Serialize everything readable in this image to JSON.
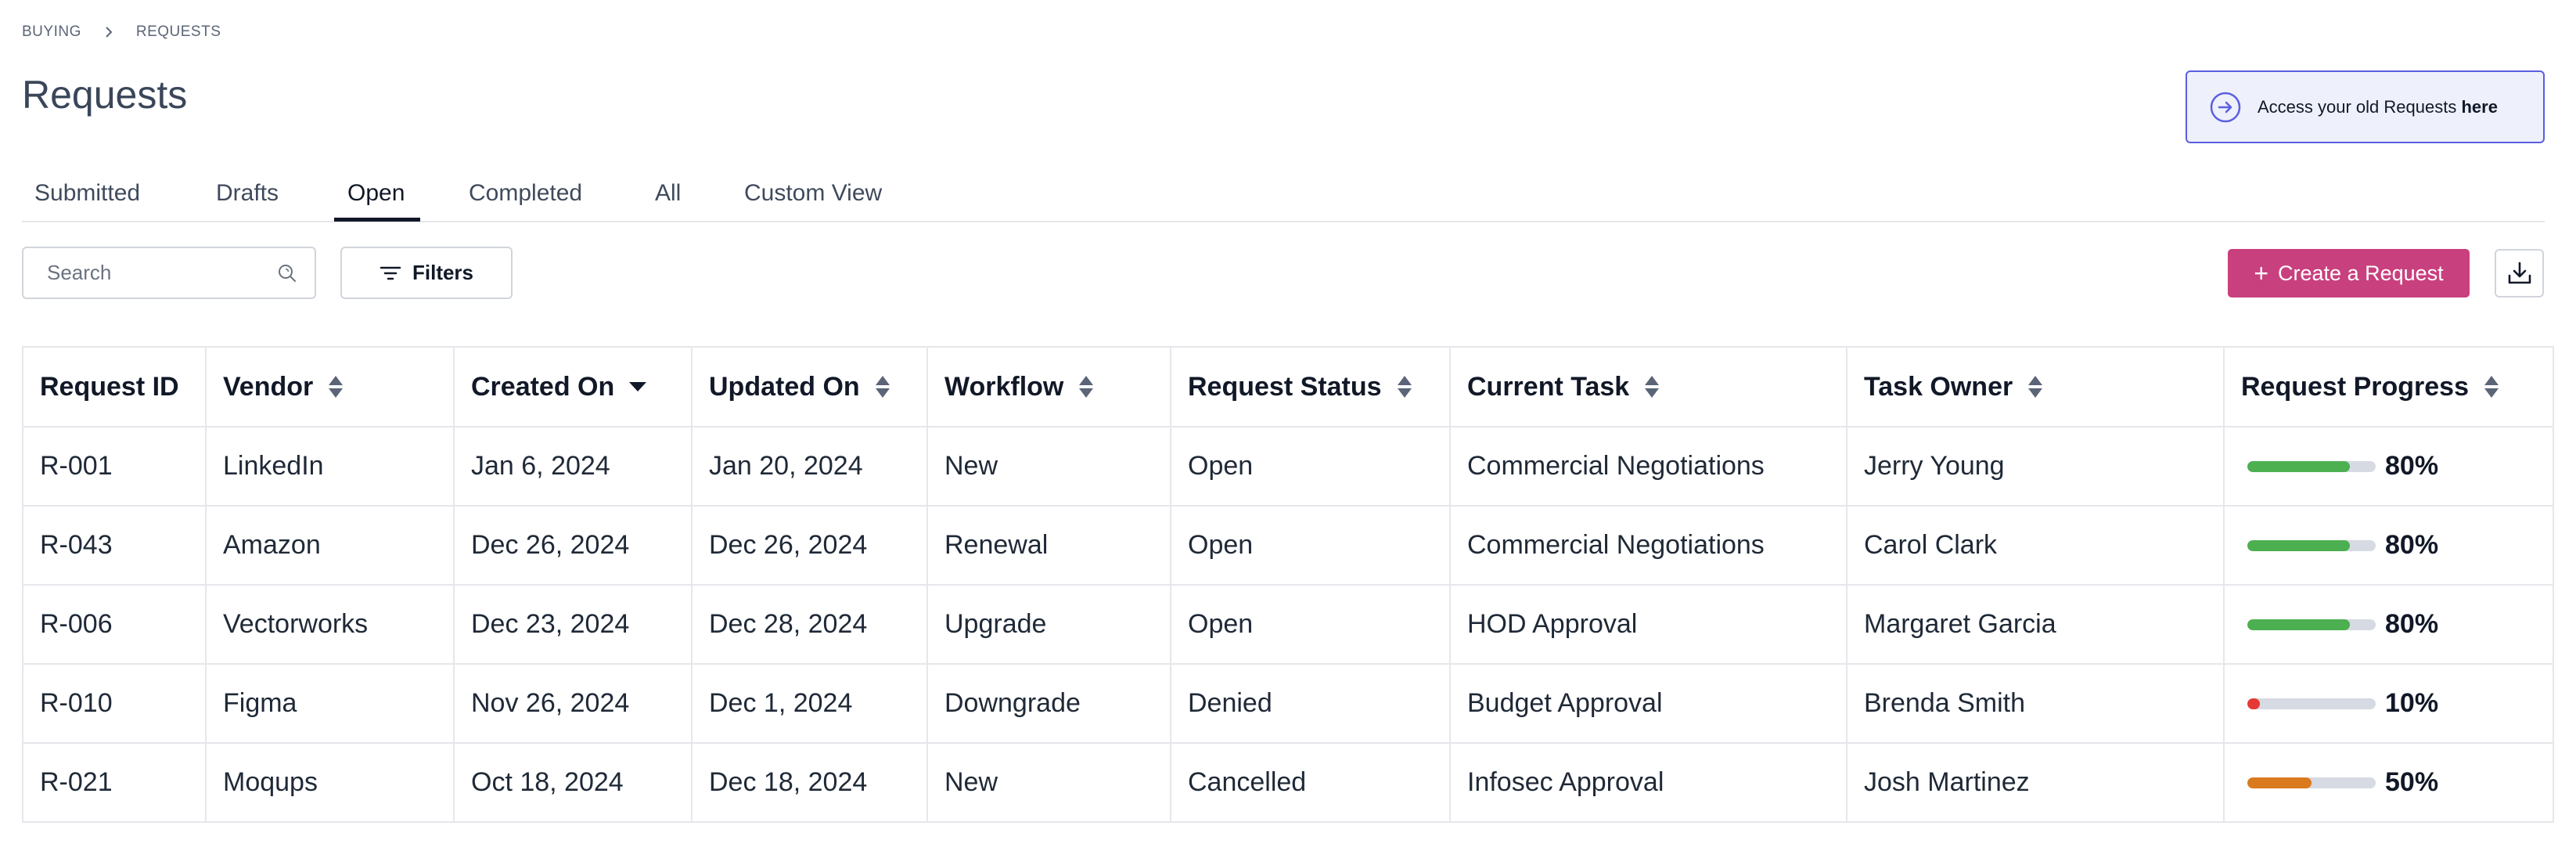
{
  "breadcrumb": {
    "items": [
      "BUYING",
      "REQUESTS"
    ]
  },
  "page": {
    "title": "Requests"
  },
  "old_requests": {
    "text": "Access your old Requests ",
    "link": "here"
  },
  "tabs": [
    {
      "label": "Submitted",
      "active": false
    },
    {
      "label": "Drafts",
      "active": false
    },
    {
      "label": "Open",
      "active": true
    },
    {
      "label": "Completed",
      "active": false
    },
    {
      "label": "All",
      "active": false
    },
    {
      "label": "Custom View",
      "active": false
    }
  ],
  "search": {
    "placeholder": "Search",
    "value": ""
  },
  "toolbar": {
    "filters_label": "Filters",
    "create_label": "Create a Request"
  },
  "colors": {
    "accent": "#c9407e",
    "green": "#4caf50",
    "red": "#e53935",
    "orange": "#d97a1e",
    "link_border": "#5a5fe0"
  },
  "table": {
    "columns": [
      {
        "label": "Request ID",
        "sort": "none"
      },
      {
        "label": "Vendor",
        "sort": "both"
      },
      {
        "label": "Created On",
        "sort": "desc"
      },
      {
        "label": "Updated On",
        "sort": "both"
      },
      {
        "label": "Workflow",
        "sort": "both"
      },
      {
        "label": "Request Status",
        "sort": "both"
      },
      {
        "label": "Current Task",
        "sort": "both"
      },
      {
        "label": "Task Owner",
        "sort": "both"
      },
      {
        "label": "Request Progress",
        "sort": "both"
      }
    ],
    "rows": [
      {
        "id": "R-001",
        "vendor": "LinkedIn",
        "created": "Jan 6, 2024",
        "updated": "Jan 20, 2024",
        "workflow": "New",
        "status": "Open",
        "task": "Commercial Negotiations",
        "owner": "Jerry Young",
        "progress": 80,
        "progress_label": "80%",
        "progress_color": "#4caf50"
      },
      {
        "id": "R-043",
        "vendor": "Amazon",
        "created": "Dec 26, 2024",
        "updated": "Dec 26, 2024",
        "workflow": "Renewal",
        "status": "Open",
        "task": "Commercial Negotiations",
        "owner": "Carol Clark",
        "progress": 80,
        "progress_label": "80%",
        "progress_color": "#4caf50"
      },
      {
        "id": "R-006",
        "vendor": "Vectorworks",
        "created": "Dec 23, 2024",
        "updated": "Dec 28, 2024",
        "workflow": "Upgrade",
        "status": "Open",
        "task": "HOD Approval",
        "owner": "Margaret Garcia",
        "progress": 80,
        "progress_label": "80%",
        "progress_color": "#4caf50"
      },
      {
        "id": "R-010",
        "vendor": "Figma",
        "created": "Nov 26, 2024",
        "updated": "Dec 1, 2024",
        "workflow": "Downgrade",
        "status": "Denied",
        "task": "Budget Approval",
        "owner": "Brenda Smith",
        "progress": 10,
        "progress_label": "10%",
        "progress_color": "#e53935"
      },
      {
        "id": "R-021",
        "vendor": "Moqups",
        "created": "Oct 18, 2024",
        "updated": "Dec 18, 2024",
        "workflow": "New",
        "status": "Cancelled",
        "task": "Infosec Approval",
        "owner": "Josh Martinez",
        "progress": 50,
        "progress_label": "50%",
        "progress_color": "#d97a1e"
      }
    ]
  }
}
